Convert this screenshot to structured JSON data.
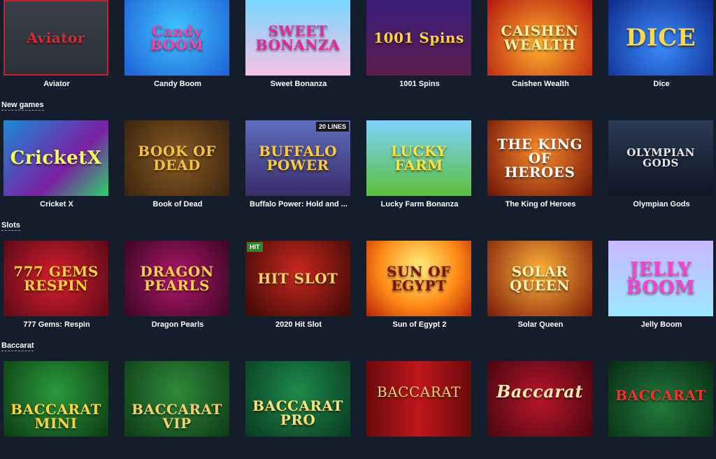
{
  "sections": {
    "new_games": "New games",
    "slots": "Slots",
    "baccarat": "Baccarat"
  },
  "rows": [
    {
      "games": [
        {
          "name": "Aviator",
          "art": "Aviator",
          "bg": "linear-gradient(180deg,#3a3f47,#2c3037)",
          "fg": "#d62b32"
        },
        {
          "name": "Candy Boom",
          "art": "Candy BOOM",
          "bg": "radial-gradient(circle at 50% 40%,#3ec6ff,#1f5fd6)",
          "fg": "#ff3fa5"
        },
        {
          "name": "Sweet Bonanza",
          "art": "SWEET BONANZA",
          "bg": "linear-gradient(180deg,#7ad6ff,#f7c2e6)",
          "fg": "#e8279b"
        },
        {
          "name": "1001 Spins",
          "art": "1001 Spins",
          "bg": "linear-gradient(180deg,#3a1d7a,#5b1d4f)",
          "fg": "#ffd23a"
        },
        {
          "name": "Caishen Wealth",
          "art": "CAISHEN WEALTH",
          "bg": "radial-gradient(circle at 50% 60%,#ffb32e,#b5160e)",
          "fg": "#fff1a8"
        },
        {
          "name": "Dice",
          "art": "DICE",
          "bg": "radial-gradient(circle at 50% 60%,#3a8cff,#0f2a8a)",
          "fg": "#ffd84a"
        }
      ]
    },
    {
      "games": [
        {
          "name": "Cricket X",
          "art": "CricketX",
          "bg": "linear-gradient(135deg,#1a8bd6,#7b1fa2 60%,#2bd36a)",
          "fg": "#f3ff5a"
        },
        {
          "name": "Book of Dead",
          "art": "BOOK OF DEAD",
          "bg": "radial-gradient(circle at 50% 50%,#8a5b21,#3a2410)",
          "fg": "#f2c14a"
        },
        {
          "name": "Buffalo Power: Hold and ...",
          "art": "BUFFALO POWER",
          "bg": "linear-gradient(180deg,#5c6fbd,#3a2b6b)",
          "fg": "#ffcc33"
        },
        {
          "name": "Lucky Farm Bonanza",
          "art": "LUCKY FARM",
          "bg": "linear-gradient(180deg,#7fd3ff,#5bbf3a)",
          "fg": "#ffe23a"
        },
        {
          "name": "The King of Heroes",
          "art": "THE KING OF HEROES",
          "bg": "radial-gradient(circle at 50% 40%,#ff8a2a,#6a1208)",
          "fg": "#ffffff"
        },
        {
          "name": "Olympian Gods",
          "art": "OLYMPIAN GODS",
          "bg": "linear-gradient(180deg,#2a3b55,#0f1624)",
          "fg": "#e8e8e8"
        }
      ]
    },
    {
      "games": [
        {
          "name": "777 Gems: Respin",
          "art": "777 GEMS RESPIN",
          "bg": "radial-gradient(circle at 50% 50%,#d81e2c,#5c0a18)",
          "fg": "#ffd23a"
        },
        {
          "name": "Dragon Pearls",
          "art": "DRAGON PEARLS",
          "bg": "radial-gradient(circle at 50% 50%,#b0176a,#3a0624)",
          "fg": "#ffcf4a"
        },
        {
          "name": "2020 Hit Slot",
          "art": "HIT SLOT",
          "bg": "radial-gradient(circle at 50% 40%,#c8281e,#3a0806)",
          "fg": "#ffd86a"
        },
        {
          "name": "Sun of Egypt 2",
          "art": "SUN OF EGYPT",
          "bg": "radial-gradient(circle at 50% 35%,#fff07a,#ff8a16 55%,#b82208)",
          "fg": "#7a1206"
        },
        {
          "name": "Solar Queen",
          "art": "SOLAR QUEEN",
          "bg": "radial-gradient(circle at 50% 40%,#ffb23a,#7a1a08)",
          "fg": "#fff1b0"
        },
        {
          "name": "Jelly Boom",
          "art": "JELLY BOOM",
          "bg": "linear-gradient(180deg,#c9b7ff,#9be8ff)",
          "fg": "#ff3fd0"
        }
      ]
    },
    {
      "games": [
        {
          "name": "",
          "art": "BACCARAT MINI",
          "bg": "radial-gradient(circle at 50% 40%,#2a9a3a,#0c3a14)",
          "fg": "#ffd23a"
        },
        {
          "name": "",
          "art": "BACCARAT VIP",
          "bg": "radial-gradient(circle at 50% 40%,#2e8a3a,#0e3a16)",
          "fg": "#f4cf6a"
        },
        {
          "name": "",
          "art": "BACCARAT PRO",
          "bg": "radial-gradient(circle at 50% 40%,#1e8a4a,#083a22)",
          "fg": "#ffe07a"
        },
        {
          "name": "",
          "art": "BACCARAT",
          "bg": "linear-gradient(90deg,#6a0a0a,#c0161c 50%,#6a0a0a)",
          "fg": "#f4d27a"
        },
        {
          "name": "",
          "art": "Baccarat",
          "bg": "radial-gradient(circle at 50% 50%,#b8162a,#4a0610)",
          "fg": "#ffe9b0"
        },
        {
          "name": "",
          "art": "BACCARAT",
          "bg": "radial-gradient(circle at 50% 60%,#1f7a3a,#0a2a14)",
          "fg": "#ff2a2a"
        }
      ]
    }
  ],
  "badges": {
    "buffalo_lines": "20 LINES",
    "hit": "HIT"
  }
}
